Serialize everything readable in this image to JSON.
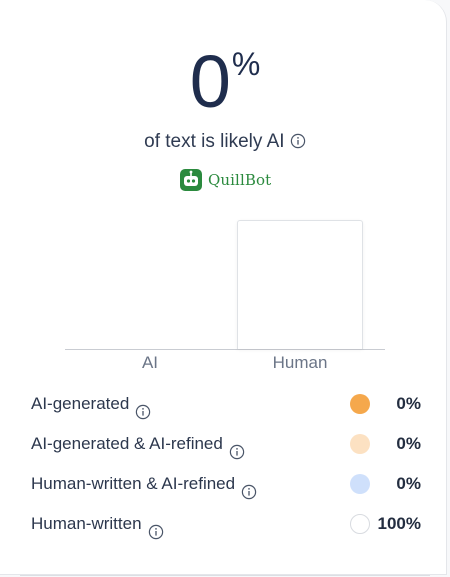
{
  "score": {
    "value": "0",
    "unit": "%"
  },
  "summary_text": "of text is likely AI",
  "brand": {
    "name": "QuillBot",
    "color": "#2b8a3e"
  },
  "chart_data": {
    "type": "bar",
    "categories": [
      "AI",
      "Human"
    ],
    "values": [
      0,
      100
    ],
    "ylim": [
      0,
      100
    ],
    "grid": false
  },
  "legend": {
    "items": [
      {
        "label": "AI-generated",
        "value": "0%",
        "color": "#f5a84c",
        "icon": "info-icon"
      },
      {
        "label": "AI-generated & AI-refined",
        "value": "0%",
        "color": "#fce1c2",
        "icon": "info-icon"
      },
      {
        "label": "Human-written & AI-refined",
        "value": "0%",
        "color": "#cfe0fb",
        "icon": "info-icon"
      },
      {
        "label": "Human-written",
        "value": "100%",
        "color": "#ffffff",
        "icon": "info-icon"
      }
    ]
  }
}
